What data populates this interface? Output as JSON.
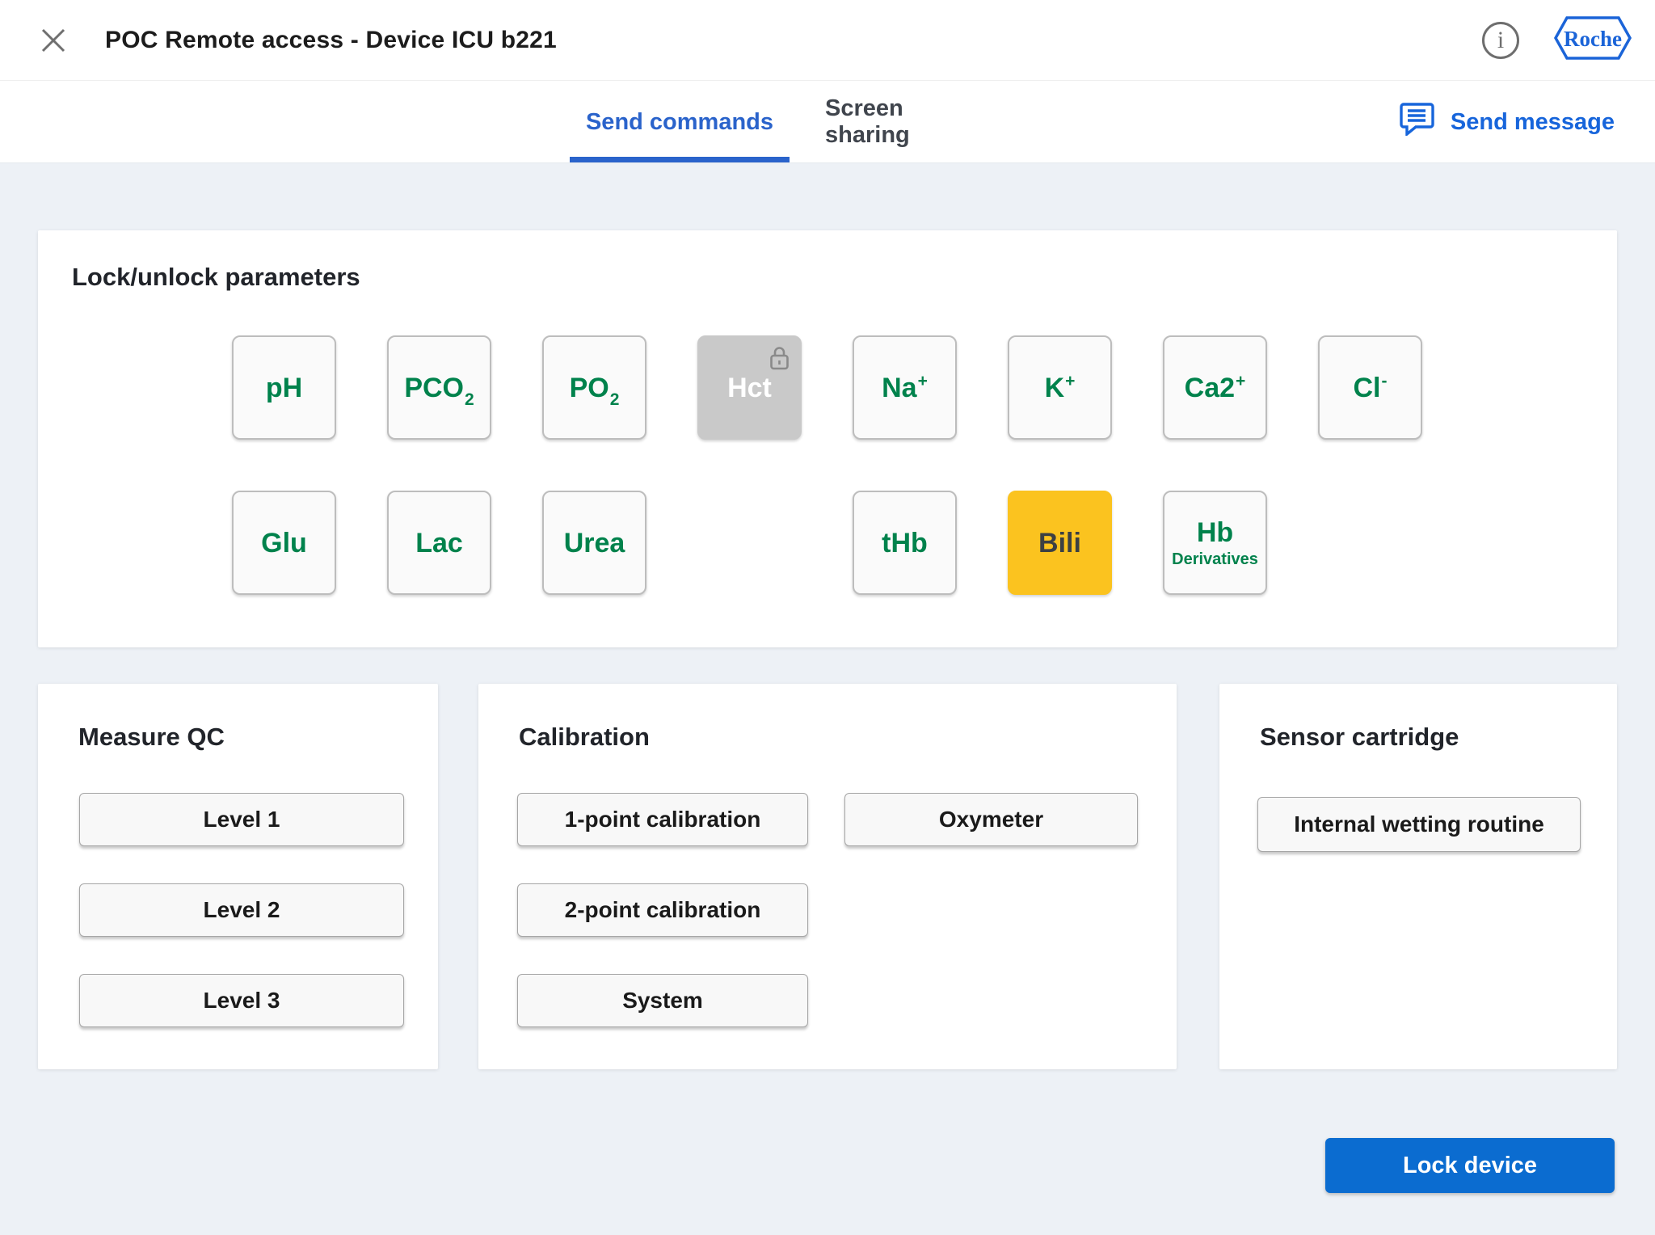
{
  "colors": {
    "accent_blue": "#2A63CB",
    "action_blue": "#0B6CD0",
    "link_blue": "#1765DB",
    "brand_blue": "#1B64D8",
    "parameter_green": "#00824C",
    "selected_yellow": "#FBC31F",
    "locked_gray": "#C9C9C9",
    "page_background": "#EDF1F6"
  },
  "icons": {
    "close": "close-x",
    "info": "info-circle-i",
    "brand": "roche-hexagon",
    "message": "speech-bubble-lines",
    "lock": "padlock-closed"
  },
  "header": {
    "title": "POC Remote access - Device ICU b221",
    "brand": "Roche"
  },
  "tabs": {
    "send_commands": "Send commands",
    "screen_sharing": "Screen sharing",
    "send_message": "Send message"
  },
  "lock_unlock": {
    "title": "Lock/unlock parameters",
    "rows": [
      [
        {
          "base": "pH"
        },
        {
          "base": "PCO",
          "sub": "2"
        },
        {
          "base": "PO",
          "sub": "2"
        },
        {
          "base": "Hct",
          "state": "locked"
        },
        {
          "base": "Na",
          "sup": "+"
        },
        {
          "base": "K",
          "sup": "+"
        },
        {
          "base": "Ca2",
          "sup": "+"
        },
        {
          "base": "Cl",
          "sup": "-"
        }
      ],
      [
        {
          "base": "Glu"
        },
        {
          "base": "Lac"
        },
        {
          "base": "Urea"
        },
        null,
        {
          "base": "tHb"
        },
        {
          "base": "Bili",
          "state": "selected"
        },
        {
          "base": "Hb",
          "line2": "Derivatives"
        },
        null
      ]
    ]
  },
  "measure_qc": {
    "title": "Measure QC",
    "buttons": [
      "Level 1",
      "Level 2",
      "Level 3"
    ]
  },
  "calibration": {
    "title": "Calibration",
    "left_buttons": [
      "1-point calibration",
      "2-point calibration",
      "System"
    ],
    "right_buttons": [
      "Oxymeter"
    ]
  },
  "sensor_cartridge": {
    "title": "Sensor cartridge",
    "buttons": [
      "Internal wetting routine"
    ]
  },
  "footer": {
    "lock_device": "Lock device"
  }
}
